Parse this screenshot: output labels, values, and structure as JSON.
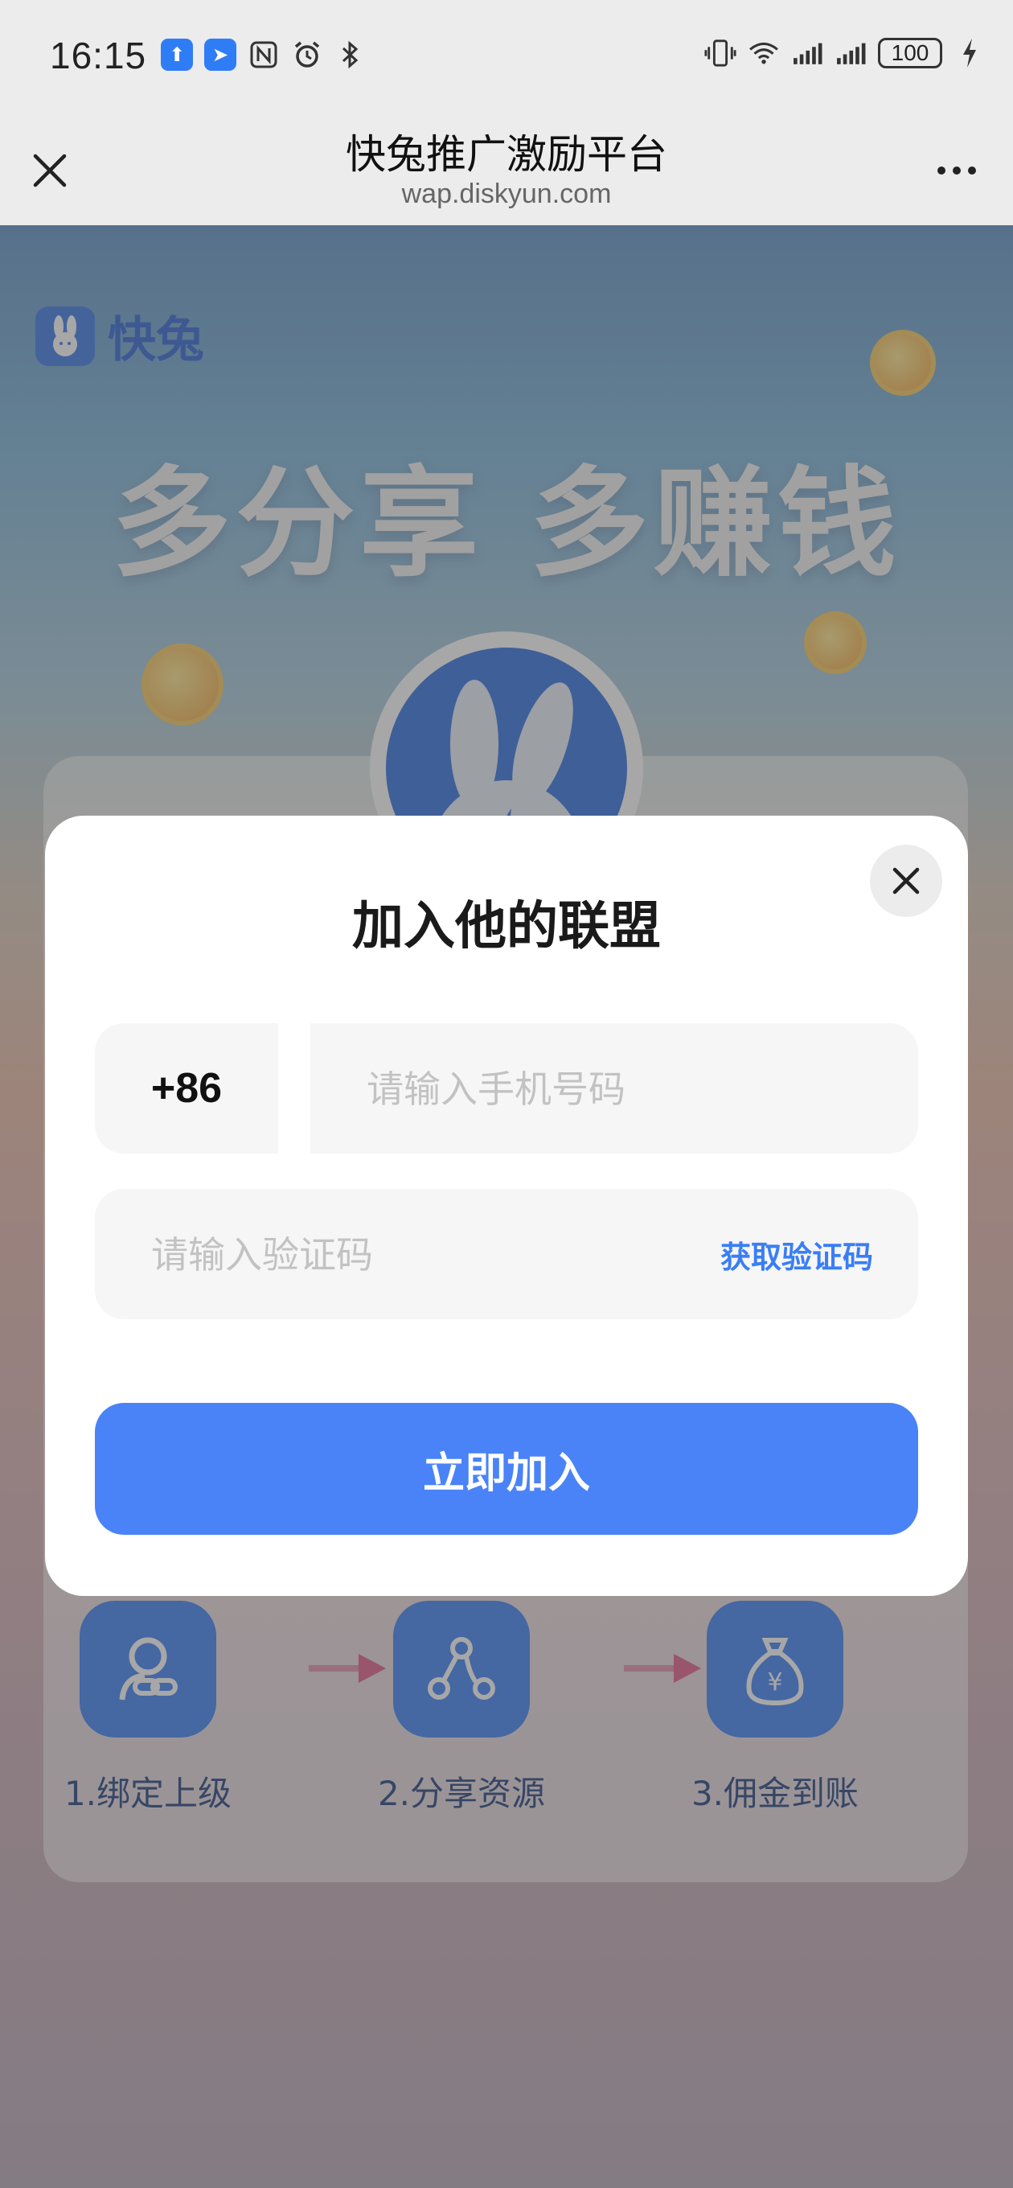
{
  "status_bar": {
    "time": "16:15",
    "left_icons": [
      "upload-app-icon",
      "direction-app-icon",
      "nfc-icon",
      "alarm-icon",
      "bluetooth-icon"
    ],
    "right_icons": [
      "vibrate-icon",
      "wifi-icon",
      "signal-icon",
      "signal-icon",
      "battery-icon",
      "charging-icon"
    ],
    "battery": "100"
  },
  "header": {
    "title": "快兔推广激励平台",
    "url": "wap.diskyun.com"
  },
  "page": {
    "logo_text": "快兔",
    "slogan": "多分享 多赚钱",
    "steps": [
      {
        "label": "1.绑定上级",
        "icon": "link-user-icon"
      },
      {
        "label": "2.分享资源",
        "icon": "share-icon"
      },
      {
        "label": "3.佣金到账",
        "icon": "money-bag-icon"
      }
    ]
  },
  "modal": {
    "title": "加入他的联盟",
    "country_code": "+86",
    "phone_placeholder": "请输入手机号码",
    "code_placeholder": "请输入验证码",
    "get_code_label": "获取验证码",
    "submit_label": "立即加入"
  },
  "colors": {
    "accent": "#4a83f7",
    "link": "#3a7ef5",
    "brand": "#2d63d4"
  }
}
